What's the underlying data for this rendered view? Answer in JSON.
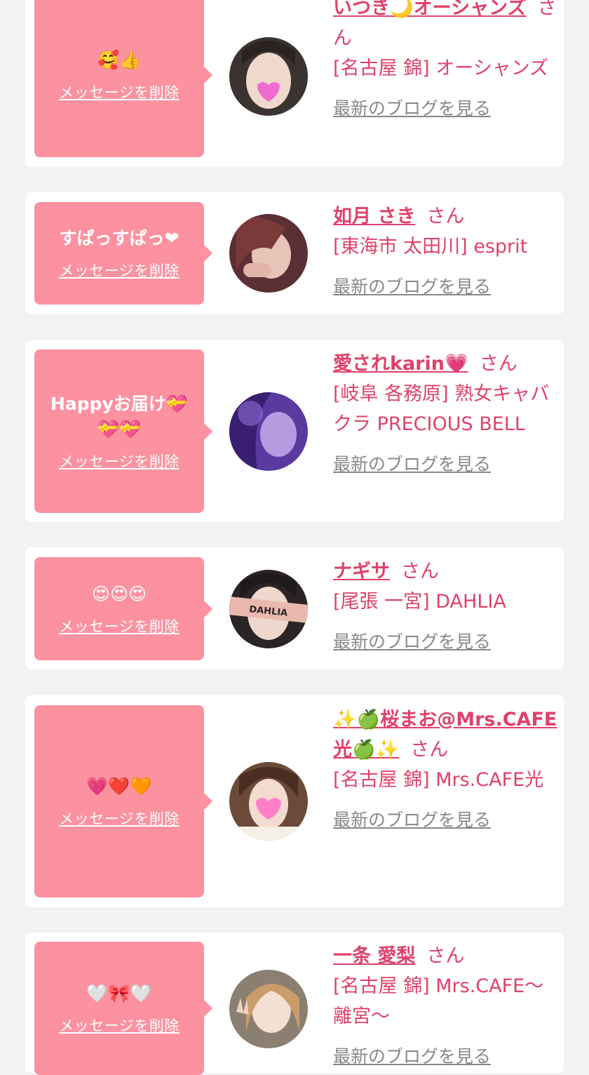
{
  "cards": [
    {
      "message": "🥰👍",
      "delete_label": "メッセージを削除",
      "name": "いつき🌙オーシャンズ",
      "san": "さん",
      "shop": "[名古屋 錦] オーシャンズ",
      "blog_label": "最新のブログを見る",
      "avatar": "avatar-woman-heart-sticker"
    },
    {
      "message": "すぱっすぱっ❤",
      "delete_label": "メッセージを削除",
      "name": "如月 さき",
      "san": "さん",
      "shop": "[東海市 太田川] esprit",
      "blog_label": "最新のブログを見る",
      "avatar": "avatar-woman-red-hair"
    },
    {
      "message": "Happyお届け💝💝💝",
      "delete_label": "メッセージを削除",
      "name": "愛されkarin💗",
      "san": "さん",
      "shop": "[岐阜 各務原]  熟女キャバクラ PRECIOUS BELL",
      "blog_label": "最新のブログを見る",
      "avatar": "avatar-woman-purple-light"
    },
    {
      "message": "😍😍😍",
      "delete_label": "メッセージを削除",
      "name": "ナギサ",
      "san": "さん",
      "shop": "[尾張 一宮] DAHLIA",
      "blog_label": "最新のブログを見る",
      "avatar": "avatar-woman-dahlia-band",
      "avatar_text": "DAHLIA"
    },
    {
      "message": "💗❤️🧡",
      "delete_label": "メッセージを削除",
      "name": "✨🍏桜まお@Mrs.CAFE光🍏✨",
      "san": "さん",
      "shop": "[名古屋 錦] Mrs.CAFE光",
      "blog_label": "最新のブログを見る",
      "avatar": "avatar-woman-pink-heart"
    },
    {
      "message": "🤍🎀🤍",
      "delete_label": "メッセージを削除",
      "name": "一条 愛梨",
      "san": "さん",
      "shop": "[名古屋 錦] Mrs.CAFE～離宮～",
      "blog_label": "最新のブログを見る",
      "avatar": "avatar-woman-peace-sign"
    }
  ]
}
